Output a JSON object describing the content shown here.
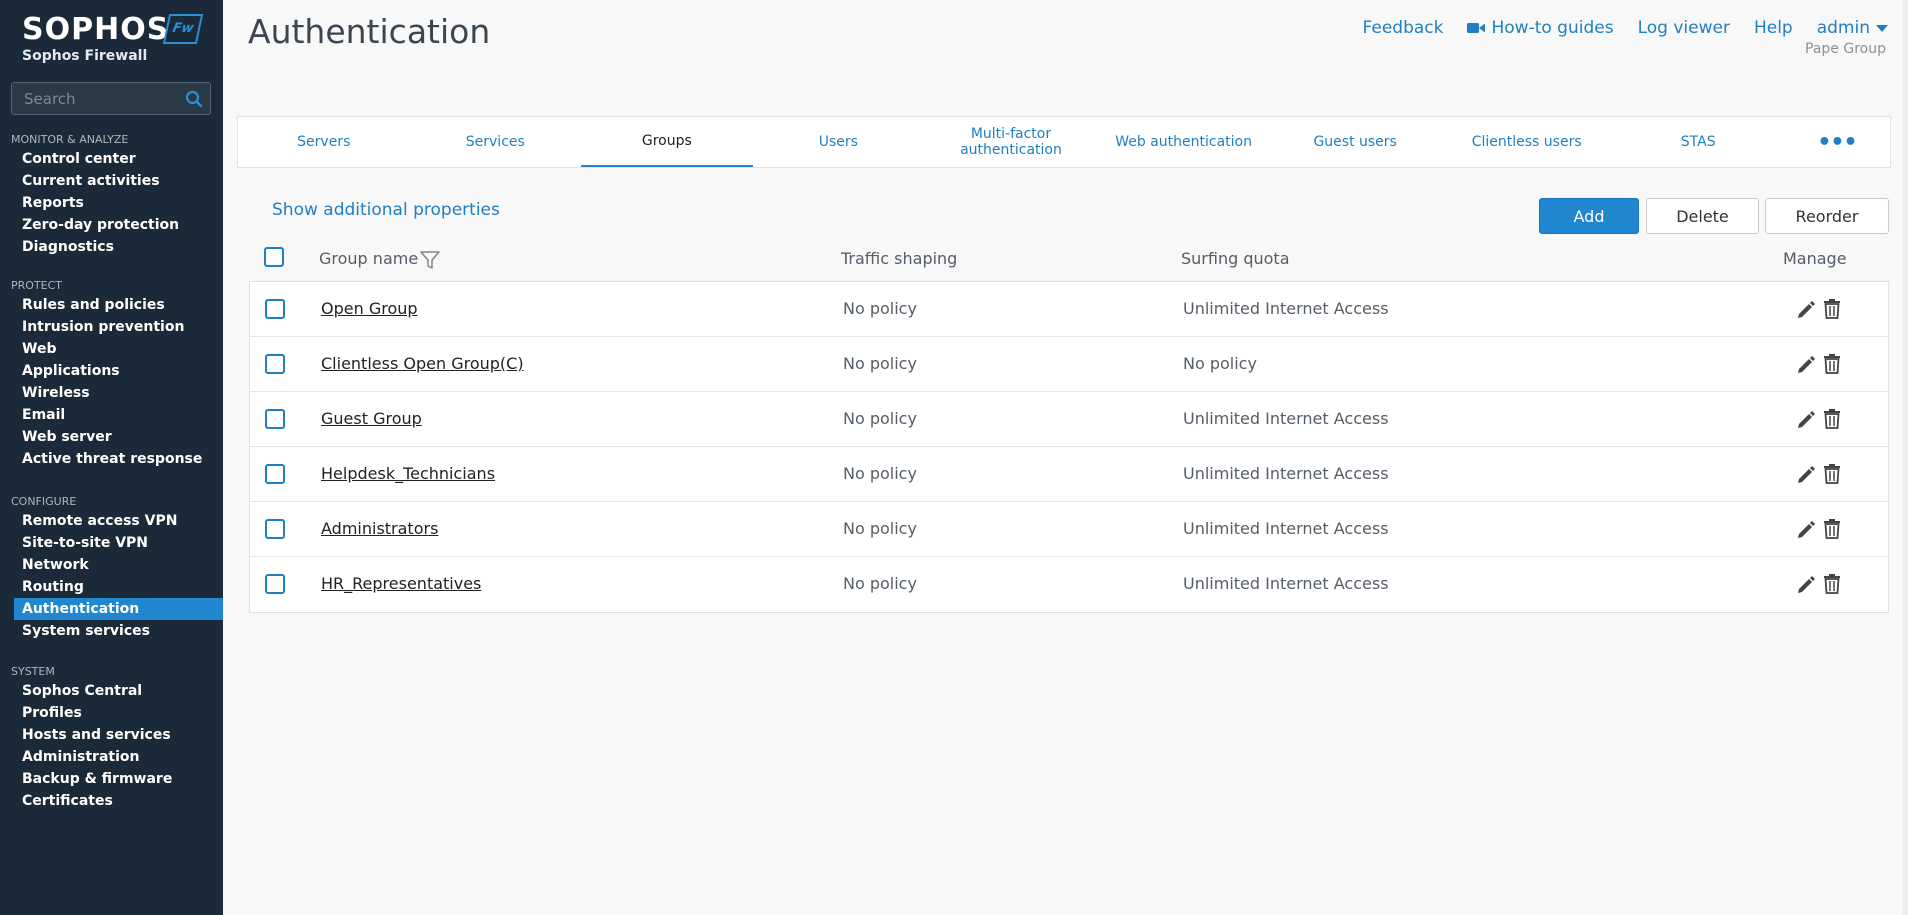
{
  "brand": {
    "name": "SOPHOS",
    "product": "Sophos Firewall",
    "badge": "Fw"
  },
  "search": {
    "placeholder": "Search"
  },
  "sidebar": {
    "sections": [
      {
        "heading": "MONITOR & ANALYZE",
        "items": [
          "Control center",
          "Current activities",
          "Reports",
          "Zero-day protection",
          "Diagnostics"
        ]
      },
      {
        "heading": "PROTECT",
        "items": [
          "Rules and policies",
          "Intrusion prevention",
          "Web",
          "Applications",
          "Wireless",
          "Email",
          "Web server",
          "Active threat response"
        ]
      },
      {
        "heading": "CONFIGURE",
        "items": [
          "Remote access VPN",
          "Site-to-site VPN",
          "Network",
          "Routing",
          "Authentication",
          "System services"
        ]
      },
      {
        "heading": "SYSTEM",
        "items": [
          "Sophos Central",
          "Profiles",
          "Hosts and services",
          "Administration",
          "Backup & firmware",
          "Certificates"
        ]
      }
    ],
    "active_item": "Authentication"
  },
  "header": {
    "title": "Authentication",
    "links": {
      "feedback": "Feedback",
      "howto": "How-to guides",
      "logviewer": "Log viewer",
      "help": "Help",
      "user": "admin"
    },
    "org": "Pape Group"
  },
  "tabs": [
    {
      "label": "Servers",
      "active": false
    },
    {
      "label": "Services",
      "active": false
    },
    {
      "label": "Groups",
      "active": true
    },
    {
      "label": "Users",
      "active": false
    },
    {
      "label": "Multi-factor authentication",
      "active": false
    },
    {
      "label": "Web authentication",
      "active": false
    },
    {
      "label": "Guest users",
      "active": false
    },
    {
      "label": "Clientless users",
      "active": false
    },
    {
      "label": "STAS",
      "active": false
    }
  ],
  "tab_more": "•••",
  "toolbar": {
    "show_props": "Show additional properties",
    "add": "Add",
    "delete": "Delete",
    "reorder": "Reorder"
  },
  "table": {
    "columns": {
      "name": "Group name",
      "traffic": "Traffic shaping",
      "quota": "Surfing quota",
      "manage": "Manage"
    },
    "rows": [
      {
        "name": "Open Group",
        "traffic": "No policy",
        "quota": "Unlimited Internet Access"
      },
      {
        "name": "Clientless Open Group(C)",
        "traffic": "No policy",
        "quota": "No policy"
      },
      {
        "name": "Guest Group",
        "traffic": "No policy",
        "quota": "Unlimited Internet Access"
      },
      {
        "name": "Helpdesk_Technicians",
        "traffic": "No policy",
        "quota": "Unlimited Internet Access"
      },
      {
        "name": "Administrators",
        "traffic": "No policy",
        "quota": "Unlimited Internet Access"
      },
      {
        "name": "HR_Representatives",
        "traffic": "No policy",
        "quota": "Unlimited Internet Access"
      }
    ]
  },
  "colors": {
    "sidebar_bg": "#1b2a38",
    "accent": "#1f86cf",
    "link": "#1f7fc4"
  }
}
